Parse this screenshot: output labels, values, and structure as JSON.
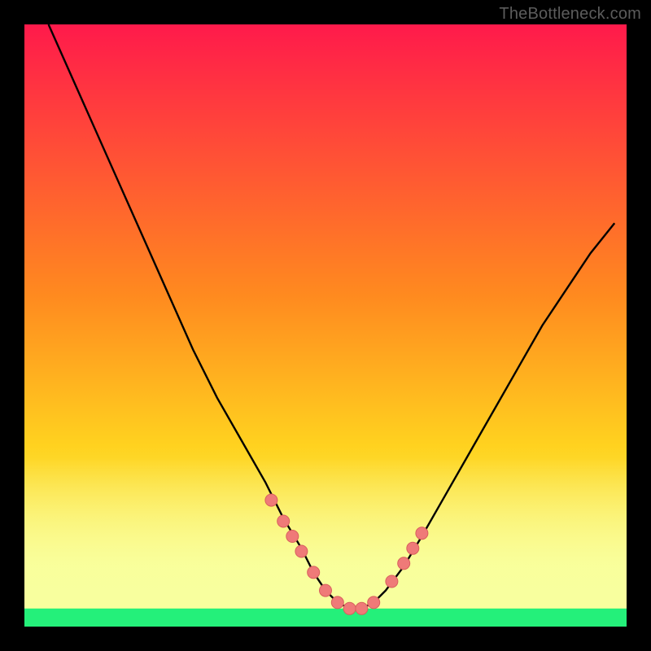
{
  "watermark": "TheBottleneck.com",
  "chart_data": {
    "type": "line",
    "title": "",
    "xlabel": "",
    "ylabel": "",
    "xlim": [
      0,
      100
    ],
    "ylim": [
      0,
      100
    ],
    "grid": false,
    "legend": false,
    "series": [
      {
        "name": "curve",
        "x": [
          4,
          8,
          12,
          16,
          20,
          24,
          28,
          32,
          36,
          40,
          43,
          46,
          48,
          50,
          52,
          54,
          56,
          58,
          60,
          63,
          66,
          70,
          74,
          78,
          82,
          86,
          90,
          94,
          98
        ],
        "y": [
          100,
          91,
          82,
          73,
          64,
          55,
          46,
          38,
          31,
          24,
          18,
          13,
          9,
          6,
          4,
          3,
          3,
          4,
          6,
          10,
          15,
          22,
          29,
          36,
          43,
          50,
          56,
          62,
          67
        ]
      }
    ],
    "markers": {
      "name": "dots",
      "x": [
        41,
        43,
        44.5,
        46,
        48,
        50,
        52,
        54,
        56,
        58,
        61,
        63,
        64.5,
        66
      ],
      "y": [
        21,
        17.5,
        15,
        12.5,
        9,
        6,
        4,
        3,
        3,
        4,
        7.5,
        10.5,
        13,
        15.5
      ]
    },
    "bottom_band": {
      "y_from": 0,
      "y_to": 3,
      "color": "#24f07a"
    },
    "glow_band": {
      "y_from": 3,
      "y_to": 28,
      "color_top": "rgba(255,255,210,0)",
      "color_bottom": "#f8ffa0"
    }
  },
  "colors": {
    "gradient_top": "#ff1a4b",
    "gradient_mid": "#ffd21f",
    "gradient_bottom": "#24f07a",
    "curve": "#000000",
    "marker_fill": "#ef7a78",
    "marker_stroke": "#d85f5d"
  }
}
